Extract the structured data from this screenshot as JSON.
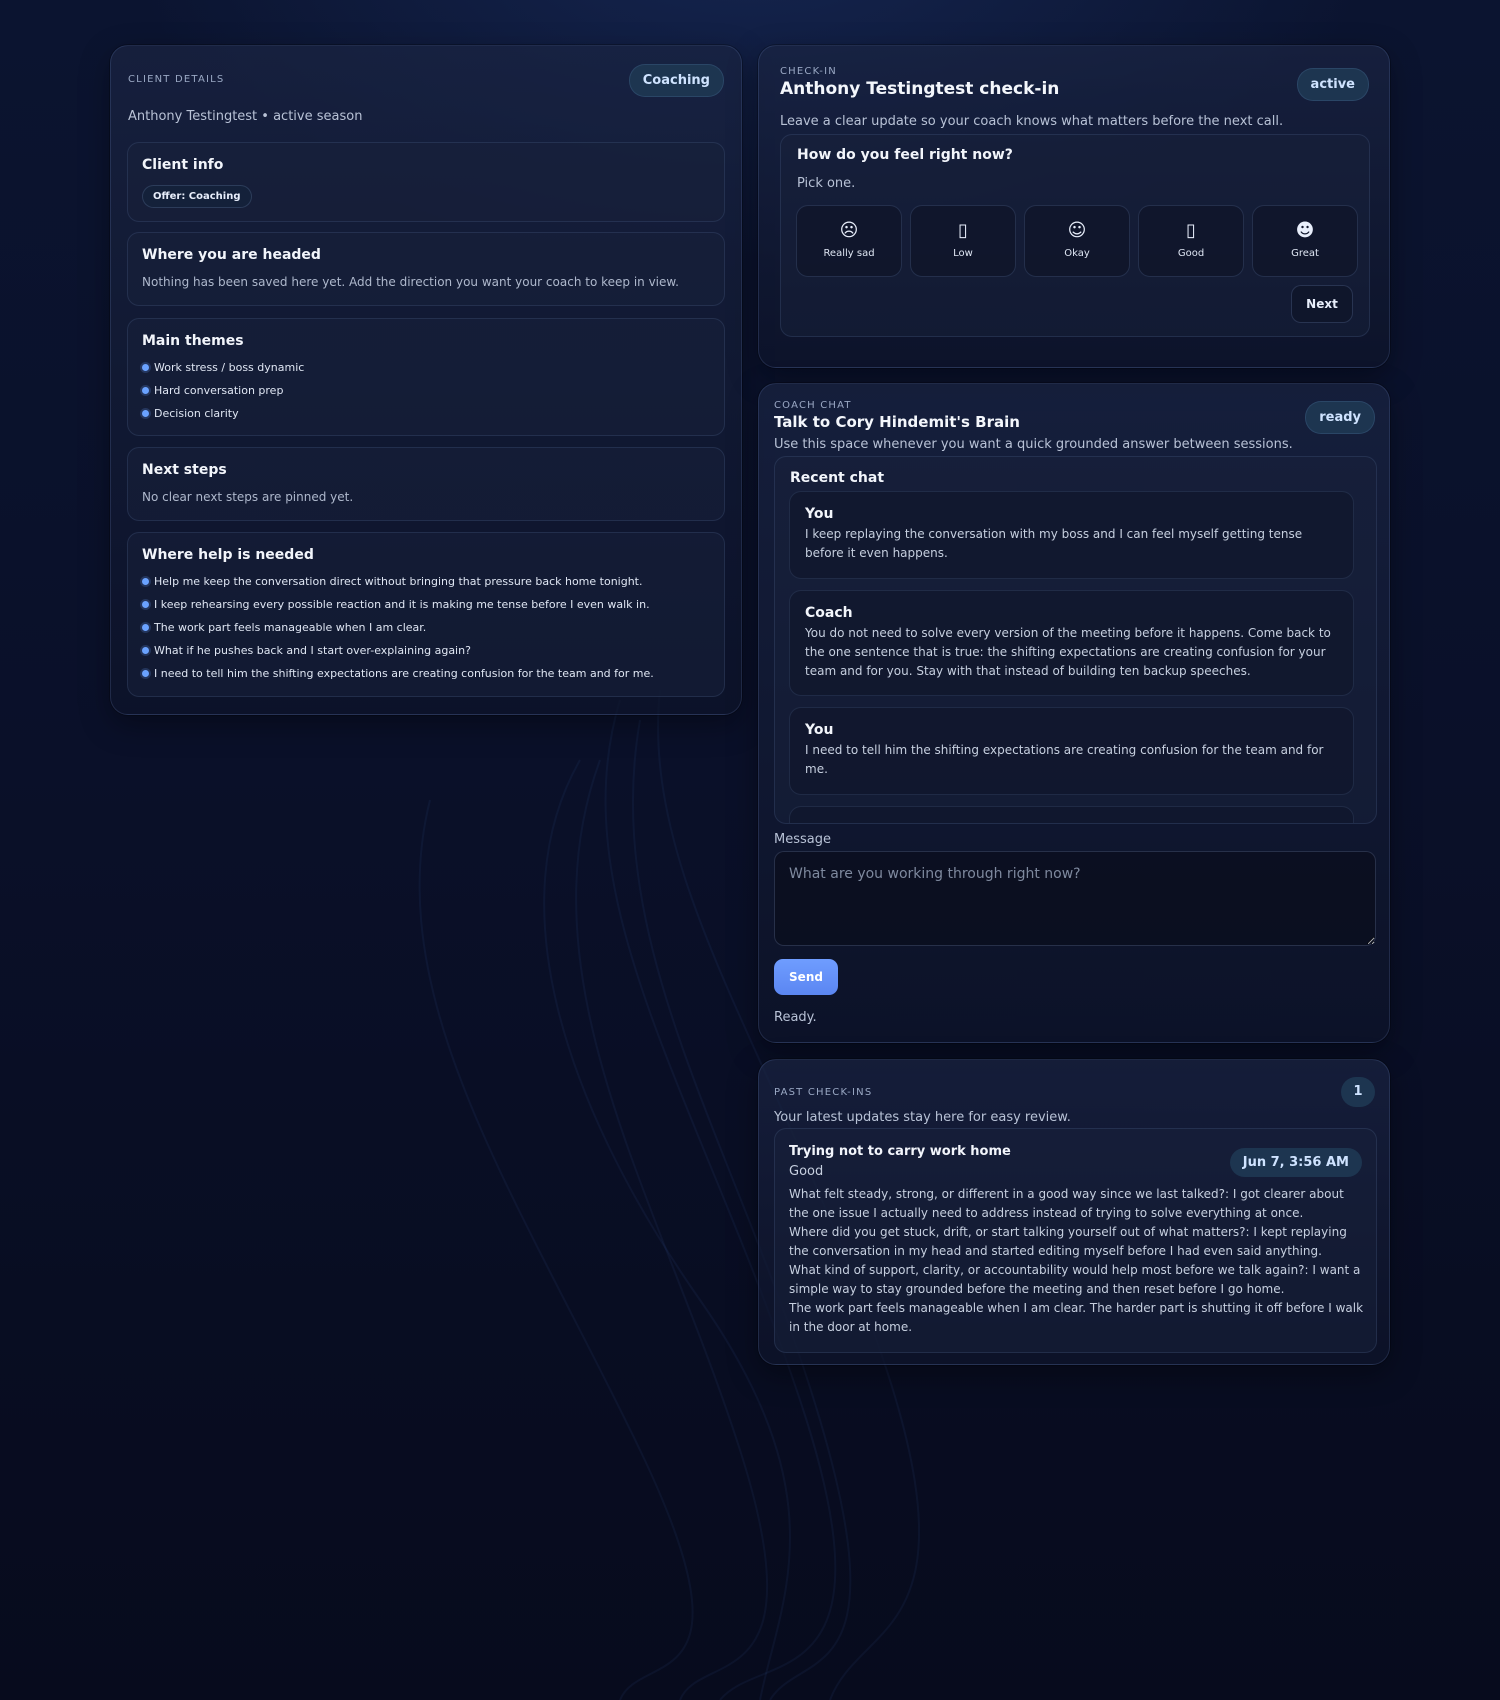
{
  "client": {
    "eyebrow": "CLIENT DETAILS",
    "badge": "Coaching",
    "subtitle": "Anthony Testingtest • active season",
    "info": {
      "title": "Client info",
      "offer": "Offer: Coaching"
    },
    "headed": {
      "title": "Where you are headed",
      "text": "Nothing has been saved here yet. Add the direction you want your coach to keep in view."
    },
    "themes": {
      "title": "Main themes",
      "items": [
        "Work stress / boss dynamic",
        "Hard conversation prep",
        "Decision clarity"
      ]
    },
    "next_steps": {
      "title": "Next steps",
      "text": "No clear next steps are pinned yet."
    },
    "help": {
      "title": "Where help is needed",
      "items": [
        "Help me keep the conversation direct without bringing that pressure back home tonight.",
        "I keep rehearsing every possible reaction and it is making me tense before I even walk in.",
        "The work part feels manageable when I am clear.",
        "What if he pushes back and I start over-explaining again?",
        "I need to tell him the shifting expectations are creating confusion for the team and for me."
      ]
    }
  },
  "checkin": {
    "eyebrow": "CHECK-IN",
    "title": "Anthony Testingtest check-in",
    "badge": "active",
    "description": "Leave a clear update so your coach knows what matters before the next call.",
    "question": "How do you feel right now?",
    "hint": "Pick one.",
    "moods": [
      {
        "icon": "☹",
        "icon_name": "really-sad-face-icon",
        "label": "Really sad"
      },
      {
        "icon": "▯",
        "icon_name": "low-face-icon",
        "label": "Low"
      },
      {
        "icon": "☺",
        "icon_name": "okay-face-icon",
        "label": "Okay"
      },
      {
        "icon": "▯",
        "icon_name": "good-face-icon",
        "label": "Good"
      },
      {
        "icon": "☻",
        "icon_name": "great-face-icon",
        "label": "Great"
      }
    ],
    "next_label": "Next"
  },
  "chat": {
    "eyebrow": "COACH CHAT",
    "title": "Talk to Cory Hindemit's Brain",
    "badge": "ready",
    "description": "Use this space whenever you want a quick grounded answer between sessions.",
    "recent_title": "Recent chat",
    "messages": [
      {
        "who": "You",
        "text": "I keep replaying the conversation with my boss and I can feel myself getting tense before it even happens."
      },
      {
        "who": "Coach",
        "text": "You do not need to solve every version of the meeting before it happens. Come back to the one sentence that is true: the shifting expectations are creating confusion for your team and for you. Stay with that instead of building ten backup speeches."
      },
      {
        "who": "You",
        "text": "I need to tell him the shifting expectations are creating confusion for the team and for me."
      },
      {
        "who": "",
        "text": ""
      }
    ],
    "message_label": "Message",
    "message_placeholder": "What are you working through right now?",
    "send_label": "Send",
    "status": "Ready."
  },
  "past": {
    "eyebrow": "PAST CHECK-INS",
    "count": "1",
    "description": "Your latest updates stay here for easy review.",
    "entry": {
      "title": "Trying not to carry work home",
      "mood": "Good",
      "date": "Jun 7, 3:56 AM",
      "lines": [
        "What felt steady, strong, or different in a good way since we last talked?: I got clearer about the one issue I actually need to address instead of trying to solve everything at once.",
        "Where did you get stuck, drift, or start talking yourself out of what matters?: I kept replaying the conversation in my head and started editing myself before I had even said anything.",
        "What kind of support, clarity, or accountability would help most before we talk again?: I want a simple way to stay grounded before the meeting and then reset before I go home.",
        "The work part feels manageable when I am clear. The harder part is shutting it off before I walk in the door at home."
      ]
    }
  },
  "colors": {
    "accent": "#5b86f2",
    "badge_bg": "#1d3550",
    "bullet": "#6aa2ff",
    "background": "#0a1029"
  }
}
